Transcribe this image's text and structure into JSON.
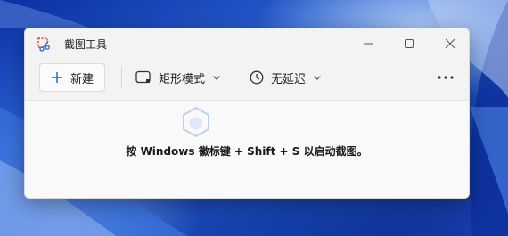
{
  "window": {
    "title": "截图工具"
  },
  "toolbar": {
    "new_label": "新建",
    "mode_label": "矩形模式",
    "delay_label": "无延迟"
  },
  "content": {
    "hint": "按 Windows 徽标键 + Shift + S 以启动截图。"
  },
  "icons": {
    "app": "snipping-tool-icon",
    "minimize": "minimize-icon",
    "maximize": "maximize-icon",
    "close": "close-icon",
    "new": "plus-icon",
    "mode": "rectangle-snip-icon",
    "delay": "clock-icon",
    "more": "more-dots-icon"
  },
  "colors": {
    "accent": "#0067c0",
    "window_bg": "#f3f3f3",
    "content_bg": "#f9f9f9"
  }
}
